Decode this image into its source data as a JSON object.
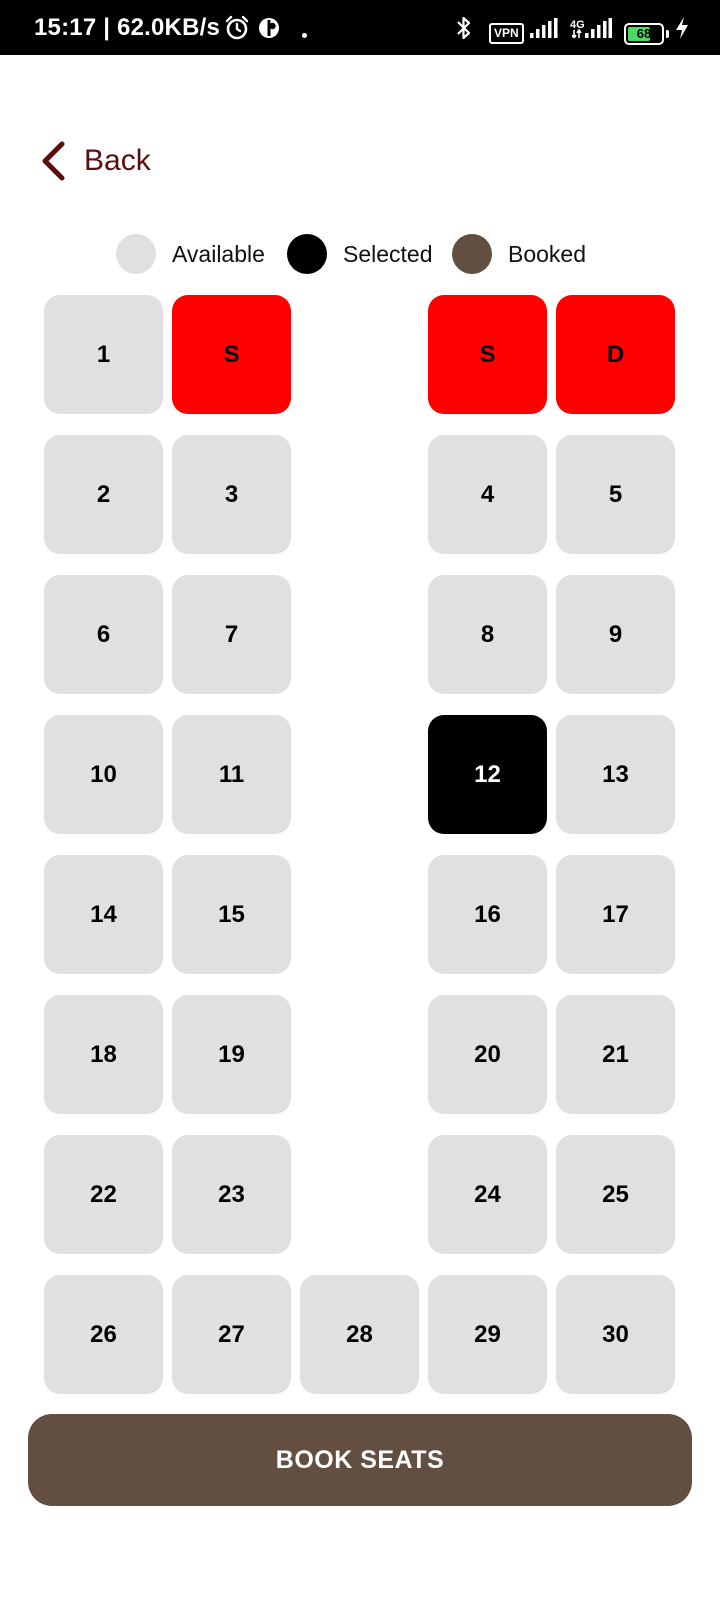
{
  "status_bar": {
    "text": "15:17 | 62.0KB/s",
    "vpn": "VPN",
    "network": "4G",
    "battery": "68",
    "battery_level": 0.68
  },
  "nav": {
    "back_label": "Back"
  },
  "legend": [
    {
      "label": "Available",
      "color": "#e0e0e0"
    },
    {
      "label": "Selected",
      "color": "#000000"
    },
    {
      "label": "Booked",
      "color": "#634f42"
    }
  ],
  "colors": {
    "available": "#e0e0e0",
    "selected": "#000000",
    "reserved": "#ff0000",
    "booked": "#634f42",
    "accent": "#5a0e0e"
  },
  "seat_rows": [
    [
      {
        "label": "1",
        "state": "available"
      },
      {
        "label": "S",
        "state": "reserved"
      },
      null,
      {
        "label": "S",
        "state": "reserved"
      },
      {
        "label": "D",
        "state": "reserved"
      }
    ],
    [
      {
        "label": "2",
        "state": "available"
      },
      {
        "label": "3",
        "state": "available"
      },
      null,
      {
        "label": "4",
        "state": "available"
      },
      {
        "label": "5",
        "state": "available"
      }
    ],
    [
      {
        "label": "6",
        "state": "available"
      },
      {
        "label": "7",
        "state": "available"
      },
      null,
      {
        "label": "8",
        "state": "available"
      },
      {
        "label": "9",
        "state": "available"
      }
    ],
    [
      {
        "label": "10",
        "state": "available"
      },
      {
        "label": "11",
        "state": "available"
      },
      null,
      {
        "label": "12",
        "state": "selected"
      },
      {
        "label": "13",
        "state": "available"
      }
    ],
    [
      {
        "label": "14",
        "state": "available"
      },
      {
        "label": "15",
        "state": "available"
      },
      null,
      {
        "label": "16",
        "state": "available"
      },
      {
        "label": "17",
        "state": "available"
      }
    ],
    [
      {
        "label": "18",
        "state": "available"
      },
      {
        "label": "19",
        "state": "available"
      },
      null,
      {
        "label": "20",
        "state": "available"
      },
      {
        "label": "21",
        "state": "available"
      }
    ],
    [
      {
        "label": "22",
        "state": "available"
      },
      {
        "label": "23",
        "state": "available"
      },
      null,
      {
        "label": "24",
        "state": "available"
      },
      {
        "label": "25",
        "state": "available"
      }
    ],
    [
      {
        "label": "26",
        "state": "available"
      },
      {
        "label": "27",
        "state": "available"
      },
      {
        "label": "28",
        "state": "available"
      },
      {
        "label": "29",
        "state": "available"
      },
      {
        "label": "30",
        "state": "available"
      }
    ]
  ],
  "actions": {
    "book_label": "BOOK SEATS"
  }
}
